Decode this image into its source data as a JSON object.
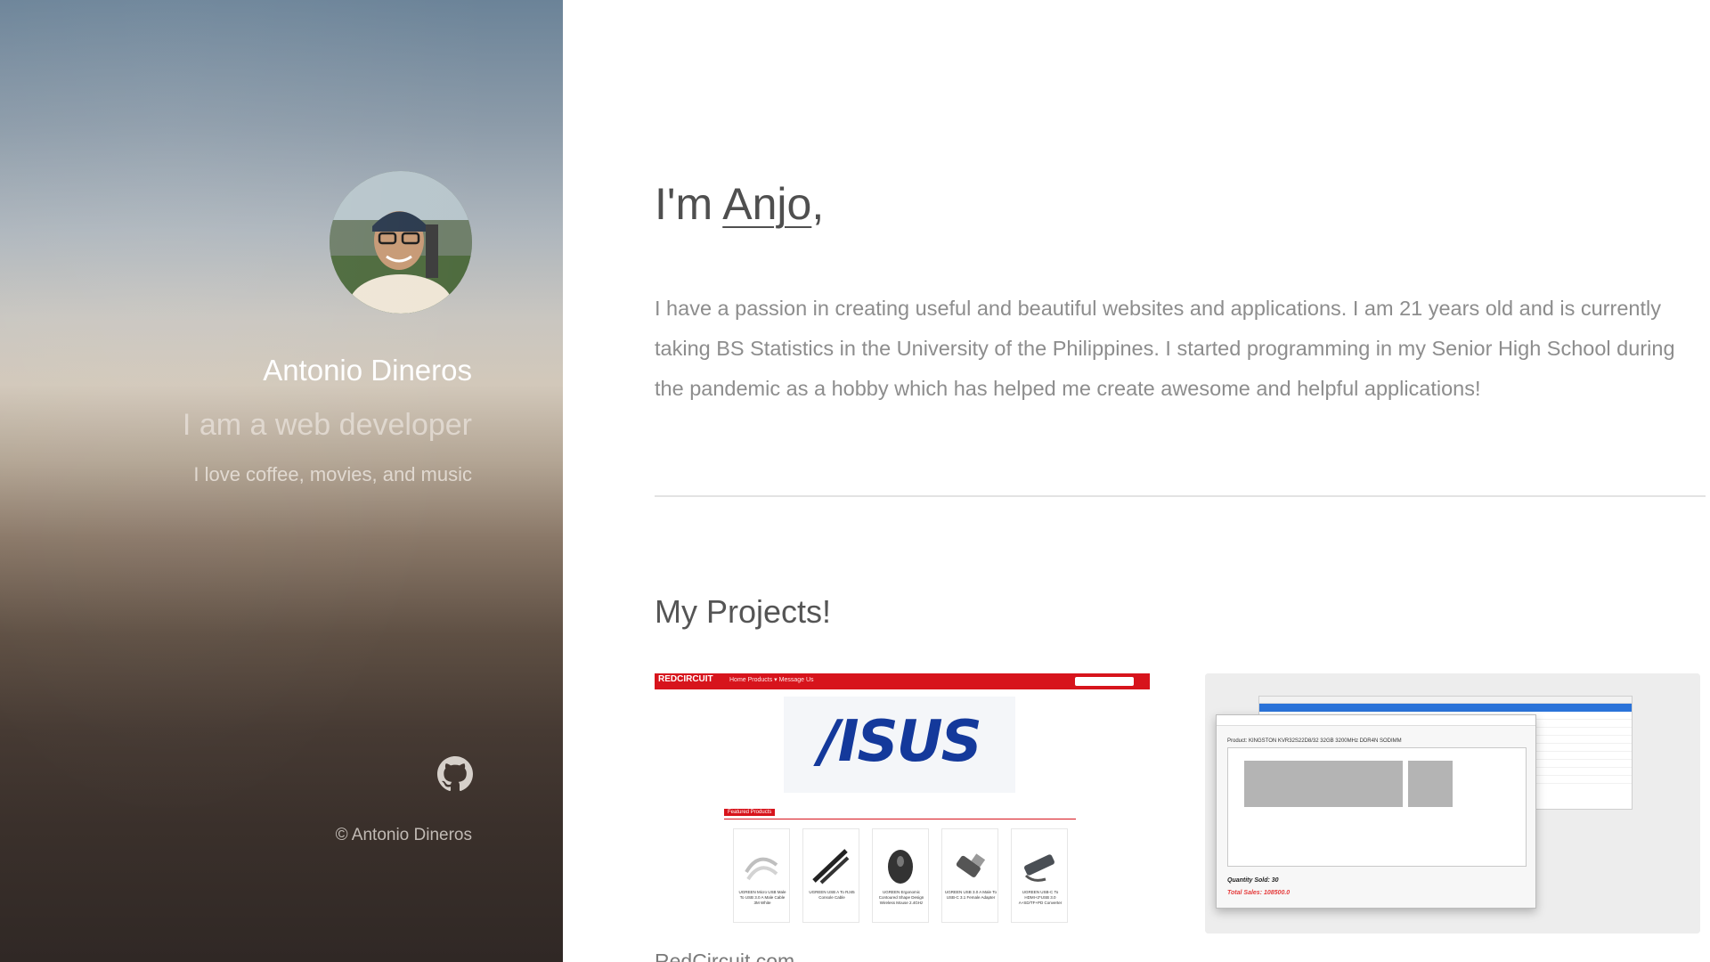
{
  "sidebar": {
    "name": "Antonio Dineros",
    "role": "I am a web developer",
    "likes": "I love coffee, movies, and music",
    "github_icon": "github-icon",
    "copyright": "© Antonio Dineros"
  },
  "main": {
    "greeting_prefix": "I'm ",
    "greeting_name": "Anjo",
    "greeting_suffix": ",",
    "about": "I have a passion in creating useful and beautiful websites and applications. I am 21 years old and is currently taking BS Statistics in the University of the Philippines. I started programming in my Senior High School during the pandemic as a hobby which has helped me create awesome and helpful applications!",
    "projects_title": "My Projects!",
    "projects": [
      {
        "caption": "RedCircuit.com",
        "logo": "REDCIRCUIT",
        "nav": "Home   Products ▾   Message Us",
        "brand": "/ISUS",
        "featured": "Featured Products",
        "products": [
          "UGREEN Micro USB Male To USB 3.0 A Male Cable 3M White",
          "UGREEN USB A To RJ45 Console Cable",
          "UGREEN Ergonomic Contoured Shape Design Wireless Mouse 2.4GHz",
          "UGREEN USB 3.0 A Male To USB-C 3.1 Female Adapter",
          "UGREEN USB-C To HDMI+2*USB 3.0 A+SD/TF+PD Converter"
        ]
      },
      {
        "product_line": "Product: KINGSTON KVR32S22D8/32 32GB 3200MHz DDR4N SODIMM",
        "quantity_sold": "Quantity Sold: 30",
        "total_sales": "Total Sales: 108500.0"
      }
    ]
  },
  "colors": {
    "rc_red": "#d7141c",
    "asus_blue": "#14399b",
    "text_dark": "#4f4f4f",
    "text_muted": "#8d8d8d"
  }
}
